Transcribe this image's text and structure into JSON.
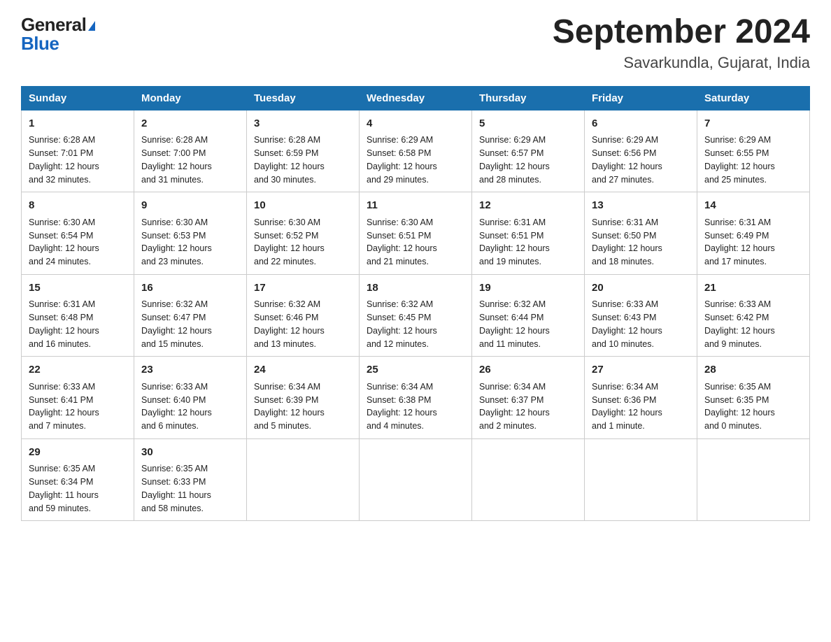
{
  "header": {
    "logo_general": "General",
    "logo_blue": "Blue",
    "month_title": "September 2024",
    "location": "Savarkundla, Gujarat, India"
  },
  "days_of_week": [
    "Sunday",
    "Monday",
    "Tuesday",
    "Wednesday",
    "Thursday",
    "Friday",
    "Saturday"
  ],
  "weeks": [
    [
      {
        "day": "1",
        "sunrise": "6:28 AM",
        "sunset": "7:01 PM",
        "daylight": "12 hours and 32 minutes."
      },
      {
        "day": "2",
        "sunrise": "6:28 AM",
        "sunset": "7:00 PM",
        "daylight": "12 hours and 31 minutes."
      },
      {
        "day": "3",
        "sunrise": "6:28 AM",
        "sunset": "6:59 PM",
        "daylight": "12 hours and 30 minutes."
      },
      {
        "day": "4",
        "sunrise": "6:29 AM",
        "sunset": "6:58 PM",
        "daylight": "12 hours and 29 minutes."
      },
      {
        "day": "5",
        "sunrise": "6:29 AM",
        "sunset": "6:57 PM",
        "daylight": "12 hours and 28 minutes."
      },
      {
        "day": "6",
        "sunrise": "6:29 AM",
        "sunset": "6:56 PM",
        "daylight": "12 hours and 27 minutes."
      },
      {
        "day": "7",
        "sunrise": "6:29 AM",
        "sunset": "6:55 PM",
        "daylight": "12 hours and 25 minutes."
      }
    ],
    [
      {
        "day": "8",
        "sunrise": "6:30 AM",
        "sunset": "6:54 PM",
        "daylight": "12 hours and 24 minutes."
      },
      {
        "day": "9",
        "sunrise": "6:30 AM",
        "sunset": "6:53 PM",
        "daylight": "12 hours and 23 minutes."
      },
      {
        "day": "10",
        "sunrise": "6:30 AM",
        "sunset": "6:52 PM",
        "daylight": "12 hours and 22 minutes."
      },
      {
        "day": "11",
        "sunrise": "6:30 AM",
        "sunset": "6:51 PM",
        "daylight": "12 hours and 21 minutes."
      },
      {
        "day": "12",
        "sunrise": "6:31 AM",
        "sunset": "6:51 PM",
        "daylight": "12 hours and 19 minutes."
      },
      {
        "day": "13",
        "sunrise": "6:31 AM",
        "sunset": "6:50 PM",
        "daylight": "12 hours and 18 minutes."
      },
      {
        "day": "14",
        "sunrise": "6:31 AM",
        "sunset": "6:49 PM",
        "daylight": "12 hours and 17 minutes."
      }
    ],
    [
      {
        "day": "15",
        "sunrise": "6:31 AM",
        "sunset": "6:48 PM",
        "daylight": "12 hours and 16 minutes."
      },
      {
        "day": "16",
        "sunrise": "6:32 AM",
        "sunset": "6:47 PM",
        "daylight": "12 hours and 15 minutes."
      },
      {
        "day": "17",
        "sunrise": "6:32 AM",
        "sunset": "6:46 PM",
        "daylight": "12 hours and 13 minutes."
      },
      {
        "day": "18",
        "sunrise": "6:32 AM",
        "sunset": "6:45 PM",
        "daylight": "12 hours and 12 minutes."
      },
      {
        "day": "19",
        "sunrise": "6:32 AM",
        "sunset": "6:44 PM",
        "daylight": "12 hours and 11 minutes."
      },
      {
        "day": "20",
        "sunrise": "6:33 AM",
        "sunset": "6:43 PM",
        "daylight": "12 hours and 10 minutes."
      },
      {
        "day": "21",
        "sunrise": "6:33 AM",
        "sunset": "6:42 PM",
        "daylight": "12 hours and 9 minutes."
      }
    ],
    [
      {
        "day": "22",
        "sunrise": "6:33 AM",
        "sunset": "6:41 PM",
        "daylight": "12 hours and 7 minutes."
      },
      {
        "day": "23",
        "sunrise": "6:33 AM",
        "sunset": "6:40 PM",
        "daylight": "12 hours and 6 minutes."
      },
      {
        "day": "24",
        "sunrise": "6:34 AM",
        "sunset": "6:39 PM",
        "daylight": "12 hours and 5 minutes."
      },
      {
        "day": "25",
        "sunrise": "6:34 AM",
        "sunset": "6:38 PM",
        "daylight": "12 hours and 4 minutes."
      },
      {
        "day": "26",
        "sunrise": "6:34 AM",
        "sunset": "6:37 PM",
        "daylight": "12 hours and 2 minutes."
      },
      {
        "day": "27",
        "sunrise": "6:34 AM",
        "sunset": "6:36 PM",
        "daylight": "12 hours and 1 minute."
      },
      {
        "day": "28",
        "sunrise": "6:35 AM",
        "sunset": "6:35 PM",
        "daylight": "12 hours and 0 minutes."
      }
    ],
    [
      {
        "day": "29",
        "sunrise": "6:35 AM",
        "sunset": "6:34 PM",
        "daylight": "11 hours and 59 minutes."
      },
      {
        "day": "30",
        "sunrise": "6:35 AM",
        "sunset": "6:33 PM",
        "daylight": "11 hours and 58 minutes."
      },
      null,
      null,
      null,
      null,
      null
    ]
  ],
  "labels": {
    "sunrise": "Sunrise:",
    "sunset": "Sunset:",
    "daylight": "Daylight:"
  }
}
